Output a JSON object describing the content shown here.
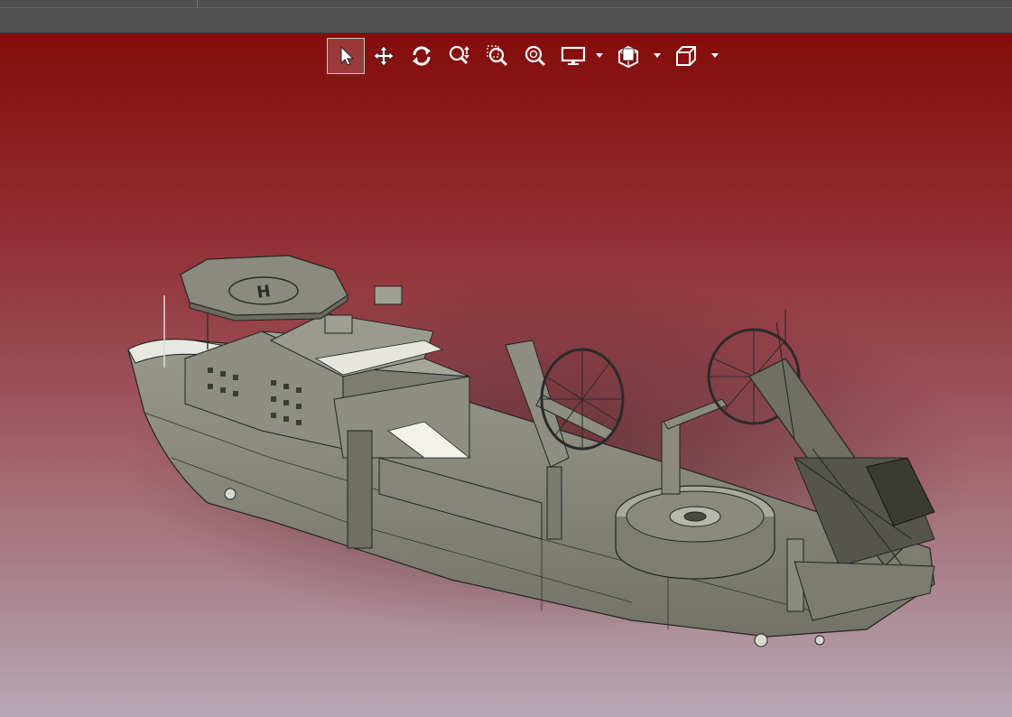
{
  "window": {
    "title": ""
  },
  "toolbar": {
    "tools": [
      {
        "name": "select",
        "icon": "cursor-arrow-icon",
        "active": true
      },
      {
        "name": "pan",
        "icon": "move-arrows-icon",
        "active": false
      },
      {
        "name": "rotate",
        "icon": "rotate-icon",
        "active": false
      },
      {
        "name": "zoom-in-out",
        "icon": "zoom-updown-icon",
        "active": false
      },
      {
        "name": "zoom-window",
        "icon": "zoom-window-icon",
        "active": false
      },
      {
        "name": "zoom-fit",
        "icon": "zoom-fit-icon",
        "active": false
      },
      {
        "name": "display-mode",
        "icon": "monitor-icon",
        "active": false,
        "dropdown": true
      },
      {
        "name": "section-view",
        "icon": "section-icon",
        "active": false,
        "dropdown": true
      },
      {
        "name": "view-orientation",
        "icon": "cube-icon",
        "active": false,
        "dropdown": true
      }
    ]
  },
  "viewport": {
    "background_top": "#850b0b",
    "background_bottom": "#b6a8b3",
    "model": "vessel-3d-model",
    "helideck_marking": "H"
  }
}
